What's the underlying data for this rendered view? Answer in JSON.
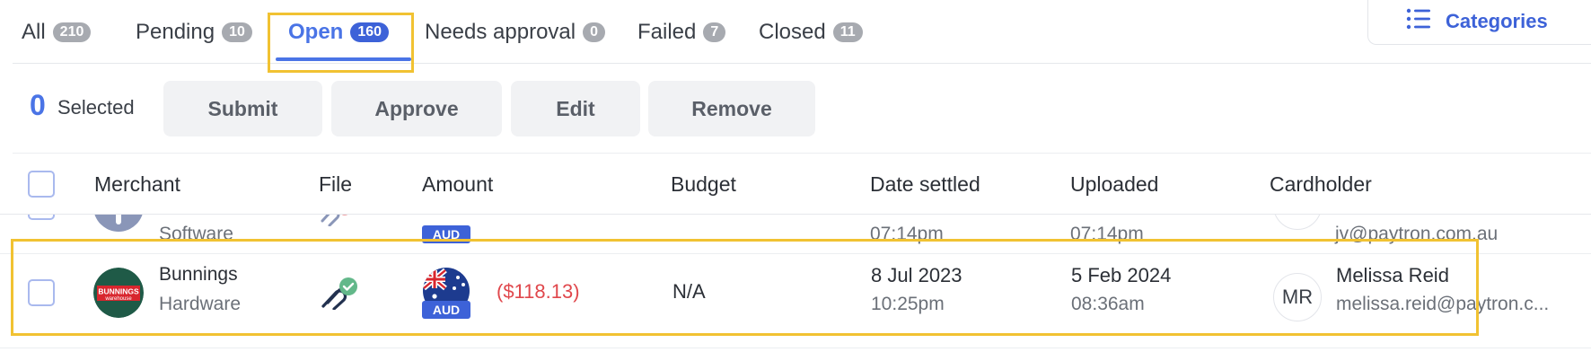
{
  "tabs": [
    {
      "label": "All",
      "count": "210"
    },
    {
      "label": "Pending",
      "count": "10"
    },
    {
      "label": "Open",
      "count": "160"
    },
    {
      "label": "Needs approval",
      "count": "0"
    },
    {
      "label": "Failed",
      "count": "7"
    },
    {
      "label": "Closed",
      "count": "11"
    }
  ],
  "categories_button": {
    "label": "Categories",
    "icon": "list-icon"
  },
  "toolbar": {
    "selected_count": "0",
    "selected_label": "Selected",
    "submit": "Submit",
    "approve": "Approve",
    "edit": "Edit",
    "remove": "Remove"
  },
  "table": {
    "columns": {
      "merchant": "Merchant",
      "file": "File",
      "amount": "Amount",
      "budget": "Budget",
      "date_settled": "Date settled",
      "uploaded": "Uploaded",
      "cardholder": "Cardholder"
    },
    "rows": [
      {
        "merchant_category": "Software",
        "amount_currency": "AUD",
        "date_settled_time": "07:14pm",
        "uploaded_time": "07:14pm",
        "cardholder_email": "jv@paytron.com.au"
      },
      {
        "merchant_name": "Bunnings",
        "merchant_category": "Hardware",
        "merchant_logo_text": [
          "BUNNINGS",
          "warehouse"
        ],
        "file_status": "attached-verified",
        "amount_currency": "AUD",
        "amount": "($118.13)",
        "budget": "N/A",
        "date_settled_date": "8 Jul 2023",
        "date_settled_time": "10:25pm",
        "uploaded_date": "5 Feb 2024",
        "uploaded_time": "08:36am",
        "cardholder_initials": "MR",
        "cardholder_name": "Melissa Reid",
        "cardholder_email": "melissa.reid@paytron.c..."
      }
    ]
  },
  "colors": {
    "accent": "#4a74e6",
    "accent_dark": "#3d62d8",
    "negative": "#e0474c",
    "highlight": "#f1c232",
    "bunnings_green": "#1f5a47",
    "bunnings_red": "#d8262e"
  }
}
